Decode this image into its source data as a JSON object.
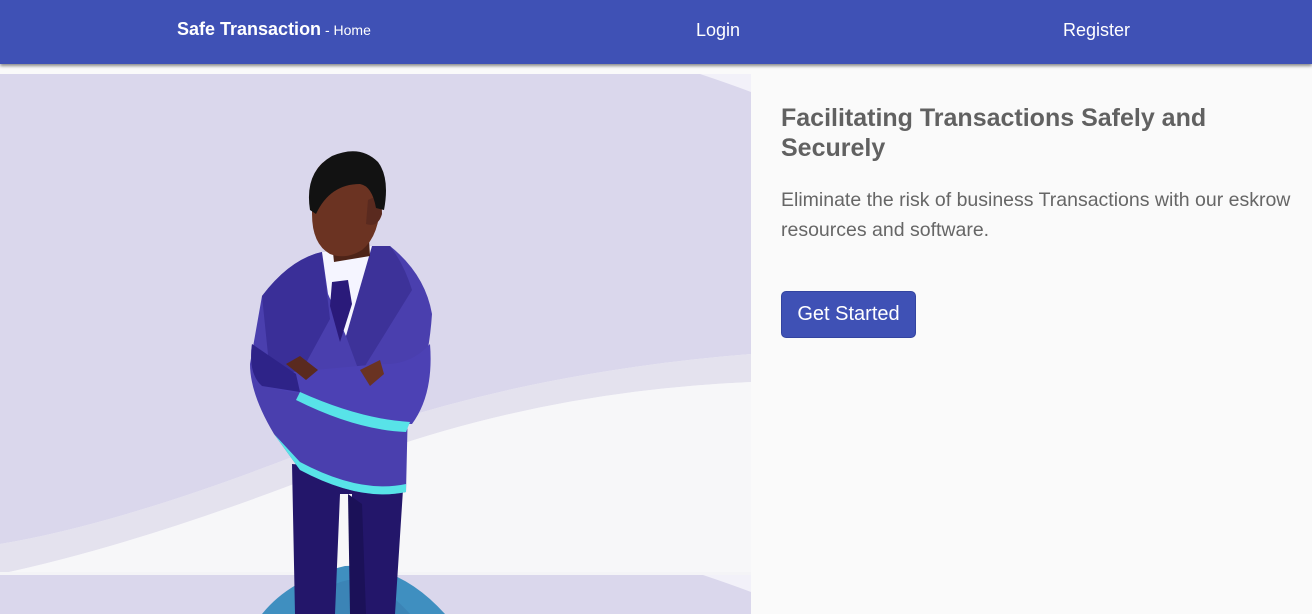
{
  "navbar": {
    "brand_name": "Safe Transaction",
    "brand_suffix": " - Home",
    "login_label": "Login",
    "register_label": "Register",
    "background_color": "#3f51b5"
  },
  "hero": {
    "title": "Facilitating Transactions Safely and Securely",
    "description": "Eliminate the risk of business Transactions with our eskrow resources and software.",
    "cta_label": "Get Started"
  },
  "illustration": {
    "subject": "businessman-with-crossed-arms"
  }
}
